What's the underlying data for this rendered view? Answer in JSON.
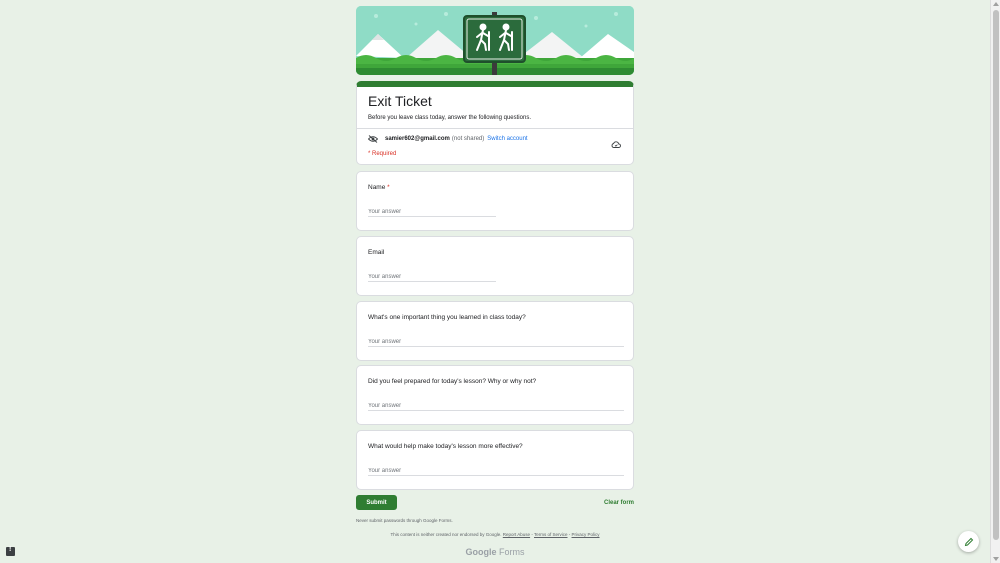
{
  "form": {
    "title": "Exit Ticket",
    "description": "Before you leave class today, answer the following questions.",
    "account": {
      "email": "samier602@gmail.com",
      "not_shared": "(not shared)",
      "switch_label": "Switch account"
    },
    "required_note": "* Required",
    "questions": [
      {
        "label": "Name",
        "required_mark": "*",
        "placeholder": "Your answer"
      },
      {
        "label": "Email",
        "required_mark": "",
        "placeholder": "Your answer"
      },
      {
        "label": "What's one important thing you learned in class today?",
        "required_mark": "",
        "placeholder": "Your answer"
      },
      {
        "label": "Did you feel prepared for today's lesson? Why or why not?",
        "required_mark": "",
        "placeholder": "Your answer"
      },
      {
        "label": "What would help make today's lesson more effective?",
        "required_mark": "",
        "placeholder": "Your answer"
      }
    ],
    "submit_label": "Submit",
    "clear_label": "Clear form",
    "never_submit": "Never submit passwords through Google Forms.",
    "footer": {
      "prefix": "This content is neither created nor endorsed by Google.",
      "report": "Report Abuse",
      "sep1": " - ",
      "terms": "Terms of Service",
      "sep2": " - ",
      "privacy": "Privacy Policy"
    },
    "brand_google": "Google",
    "brand_forms": "Forms"
  },
  "colors": {
    "background": "#e8f1e7",
    "accent": "#2f7d32",
    "link": "#1a73e8",
    "required": "#d93025"
  },
  "icons": [
    "hiker-sign-icon",
    "eye-off-icon",
    "cloud-icon",
    "report-icon",
    "pencil-icon"
  ]
}
